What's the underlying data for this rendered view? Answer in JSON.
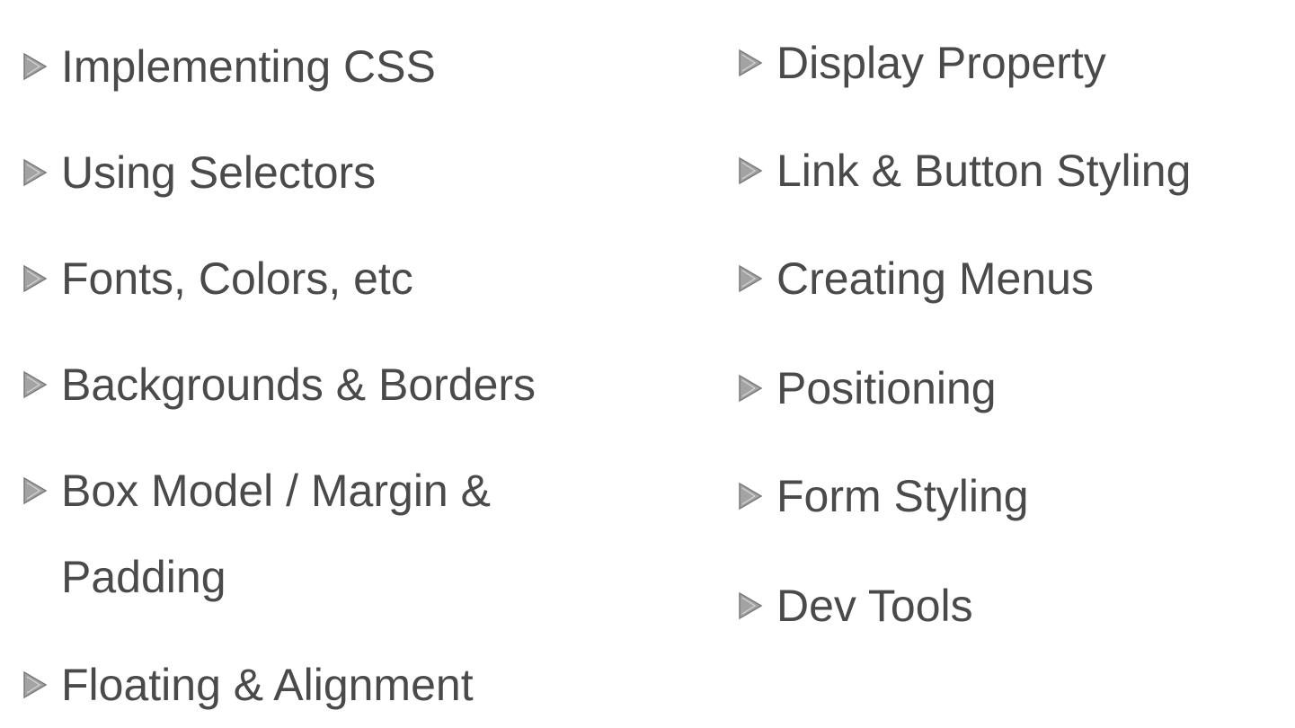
{
  "outline": {
    "left_column": [
      {
        "label": "Implementing CSS"
      },
      {
        "label": "Using Selectors"
      },
      {
        "label": "Fonts, Colors, etc"
      },
      {
        "label": "Backgrounds & Borders"
      },
      {
        "label": "Box Model / Margin & Padding"
      },
      {
        "label": "Floating & Alignment"
      }
    ],
    "right_column": [
      {
        "label": "Display Property"
      },
      {
        "label": "Link & Button Styling"
      },
      {
        "label": "Creating Menus"
      },
      {
        "label": "Positioning"
      },
      {
        "label": "Form Styling"
      },
      {
        "label": "Dev Tools"
      }
    ]
  },
  "colors": {
    "text": "#4a4a4a",
    "bullet": "#9a9a9a",
    "background": "#ffffff"
  },
  "icons": {
    "bullet": "triangle-bullet-icon"
  }
}
